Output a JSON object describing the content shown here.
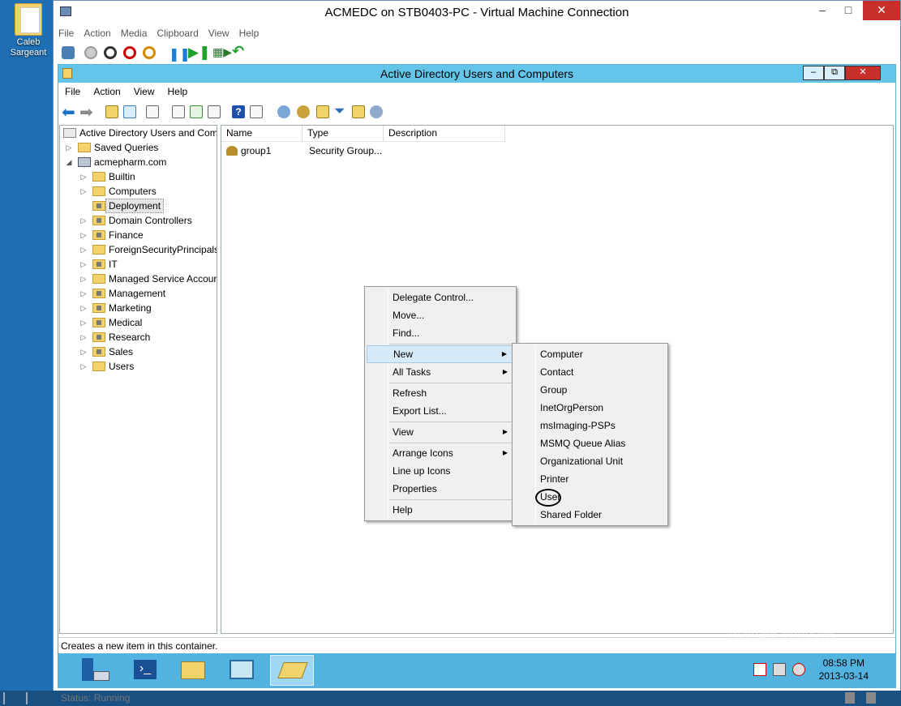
{
  "desktop": {
    "icon_label": "Caleb Sargeant"
  },
  "vm": {
    "title": "ACMEDC on STB0403-PC - Virtual Machine Connection",
    "menu": [
      "File",
      "Action",
      "Media",
      "Clipboard",
      "View",
      "Help"
    ],
    "status": "Status: Running"
  },
  "aduc": {
    "title": "Active Directory Users and Computers",
    "menu": [
      "File",
      "Action",
      "View",
      "Help"
    ],
    "tree": {
      "root": "Active Directory Users and Com",
      "saved_queries": "Saved Queries",
      "domain": "acmepharm.com",
      "children": [
        "Builtin",
        "Computers",
        "Deployment",
        "Domain Controllers",
        "Finance",
        "ForeignSecurityPrincipals",
        "IT",
        "Managed Service Accour",
        "Management",
        "Marketing",
        "Medical",
        "Research",
        "Sales",
        "Users"
      ],
      "selected": "Deployment"
    },
    "columns": [
      "Name",
      "Type",
      "Description"
    ],
    "rows": [
      {
        "name": "group1",
        "type": "Security Group..."
      }
    ],
    "status_text": "Creates a new item in this container."
  },
  "context_menu": {
    "items": [
      "Delegate Control...",
      "Move...",
      "Find...",
      "New",
      "All Tasks",
      "Refresh",
      "Export List...",
      "View",
      "Arrange Icons",
      "Line up Icons",
      "Properties",
      "Help"
    ],
    "highlighted": "New"
  },
  "submenu": {
    "items": [
      "Computer",
      "Contact",
      "Group",
      "InetOrgPerson",
      "msImaging-PSPs",
      "MSMQ Queue Alias",
      "Organizational Unit",
      "Printer",
      "User",
      "Shared Folder"
    ],
    "circled": "User"
  },
  "taskbar": {
    "clock_time": "08:58 PM",
    "clock_date": "2013-03-14"
  },
  "watermark": {
    "line1": "Activate Windows",
    "line2": "Go to PC settings to activate W"
  },
  "colors": {
    "guest_titlebar": "#64c5ea",
    "guest_taskbar": "#52b3e0",
    "menu_highlight": "#d6eaf9"
  }
}
